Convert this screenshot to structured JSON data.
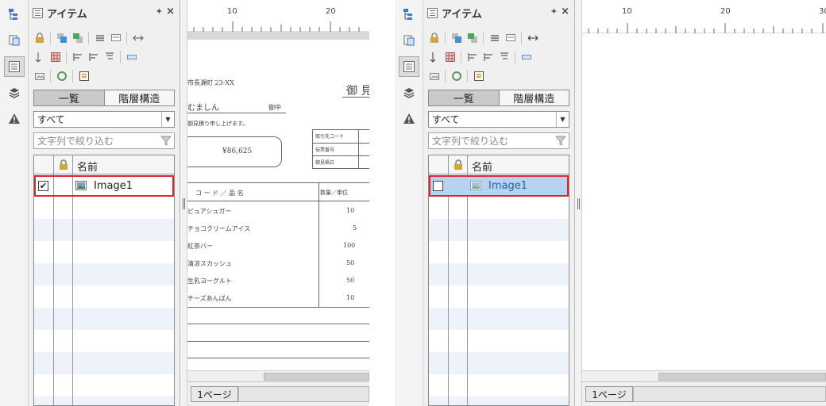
{
  "left": {
    "panel_title": "アイテム",
    "pin_glyph": "✦",
    "close_glyph": "×",
    "tab_list": "一覧",
    "tab_tree": "階層構造",
    "filter_select": "すべて",
    "filter_placeholder": "文字列で絞り込む",
    "column_name": "名前",
    "item_name": "Image1",
    "item_checked": true,
    "page_tab": "1ページ",
    "ruler": [
      "10",
      "20"
    ],
    "document": {
      "address": "市長瀬町 23-XX",
      "customer": "むましん",
      "honorific": "御中",
      "greeting": "御見積り申し上げます。",
      "title": "御 見",
      "amount": "¥86,625",
      "info_labels": [
        "取引先コード",
        "伝票番号",
        "御見積日"
      ],
      "table_header": "コ ー ド ／ 品 名",
      "qty_header": "数量／単位",
      "rows": [
        {
          "name": "ピュアシュガー",
          "qty": "10"
        },
        {
          "name": "チョコクリームアイス",
          "qty": "5"
        },
        {
          "name": "紅茶バー",
          "qty": "100"
        },
        {
          "name": "清涼スカッシュ",
          "qty": "50"
        },
        {
          "name": "生乳ヨーグルト",
          "qty": "50"
        },
        {
          "name": "チーズあんぱん",
          "qty": "10"
        }
      ]
    }
  },
  "right": {
    "panel_title": "アイテム",
    "pin_glyph": "✦",
    "close_glyph": "×",
    "tab_list": "一覧",
    "tab_tree": "階層構造",
    "filter_select": "すべて",
    "filter_placeholder": "文字列で絞り込む",
    "column_name": "名前",
    "item_name": "Image1",
    "item_checked": false,
    "page_tab": "1ページ",
    "ruler": [
      "10",
      "20",
      "30"
    ]
  },
  "colors": {
    "highlight": "#e0252e",
    "selection": "#b8d3f1"
  }
}
